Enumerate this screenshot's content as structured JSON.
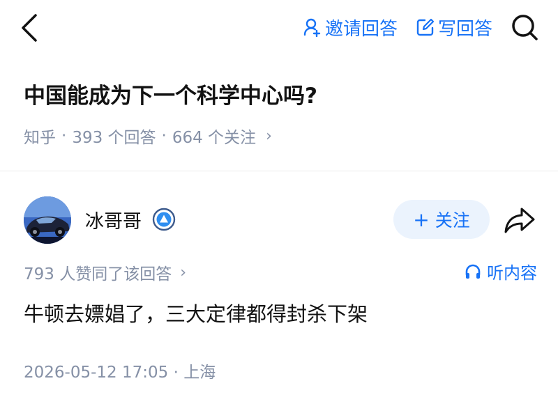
{
  "header": {
    "back_icon": "chevron-left-icon",
    "invite_label": "邀请回答",
    "invite_icon": "invite-user-icon",
    "write_label": "写回答",
    "write_icon": "edit-icon",
    "search_icon": "search-icon"
  },
  "question": {
    "title": "中国能成为下一个科学中心吗?",
    "source": "知乎",
    "answers_count": "393 个回答",
    "followers_count": "664 个关注",
    "separator": "·",
    "chevron": "›"
  },
  "author": {
    "name": "冰哥哥",
    "badge_icon": "verified-badge-icon",
    "follow_label": "关注",
    "follow_plus": "+",
    "share_icon": "share-icon"
  },
  "answer": {
    "upvote_text": "793 人赞同了该回答",
    "chevron": "›",
    "listen_label": "听内容",
    "listen_icon": "headphones-icon",
    "content": "牛顿去嫖娼了，三大定律都得封杀下架",
    "timestamp": "2026-05-12 17:05 · 上海"
  },
  "colors": {
    "accent": "#1772f6",
    "meta_gray": "#8590a6",
    "text": "#121212",
    "follow_bg": "#ebf3fd"
  }
}
